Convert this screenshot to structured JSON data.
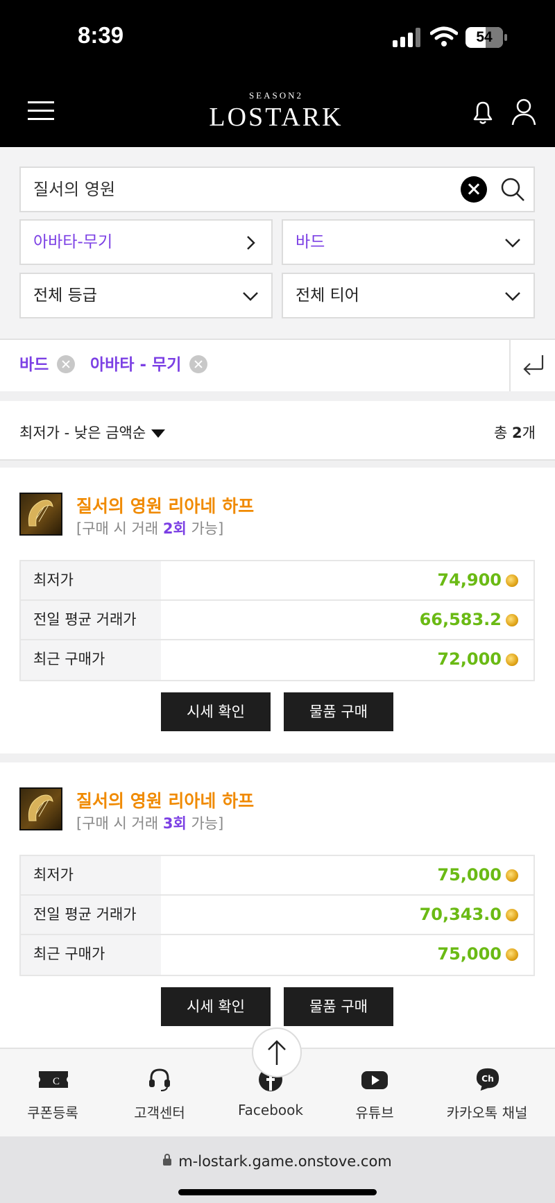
{
  "status": {
    "time": "8:39",
    "battery": "54"
  },
  "header": {
    "logo_season": "SEASON2",
    "logo_name": "LOSTARK"
  },
  "search": {
    "value": "질서의 영원"
  },
  "filters": {
    "category": "아바타-무기",
    "class": "바드",
    "grade": "전체 등급",
    "tier": "전체 티어"
  },
  "chips": [
    {
      "label": "바드"
    },
    {
      "label": "아바타 - 무기"
    }
  ],
  "sort": {
    "label": "최저가 - 낮은 금액순",
    "total_prefix": "총 ",
    "total_count": "2",
    "total_suffix": "개"
  },
  "items": [
    {
      "name": "질서의 영원 리아네 하프",
      "trade_prefix": "[구매 시 거래 ",
      "trade_count": "2회",
      "trade_suffix": " 가능]",
      "rows": [
        {
          "label": "최저가",
          "value": "74,900"
        },
        {
          "label": "전일 평균 거래가",
          "value": "66,583.2"
        },
        {
          "label": "최근 구매가",
          "value": "72,000"
        }
      ],
      "btn_price": "시세 확인",
      "btn_buy": "물품 구매"
    },
    {
      "name": "질서의 영원 리아네 하프",
      "trade_prefix": "[구매 시 거래 ",
      "trade_count": "3회",
      "trade_suffix": " 가능]",
      "rows": [
        {
          "label": "최저가",
          "value": "75,000"
        },
        {
          "label": "전일 평균 거래가",
          "value": "70,343.0"
        },
        {
          "label": "최근 구매가",
          "value": "75,000"
        }
      ],
      "btn_price": "시세 확인",
      "btn_buy": "물품 구매"
    }
  ],
  "footer": [
    {
      "label": "쿠폰등록",
      "icon": "coupon-icon"
    },
    {
      "label": "고객센터",
      "icon": "headset-icon"
    },
    {
      "label": "Facebook",
      "icon": "facebook-icon"
    },
    {
      "label": "유튜브",
      "icon": "youtube-icon"
    },
    {
      "label": "카카오톡 채널",
      "icon": "kakao-channel-icon"
    }
  ],
  "browser": {
    "url": "m-lostark.game.onstove.com"
  },
  "colors": {
    "accent_purple": "#7b3fe4",
    "item_orange": "#f08a00",
    "price_green": "#6aba14"
  }
}
